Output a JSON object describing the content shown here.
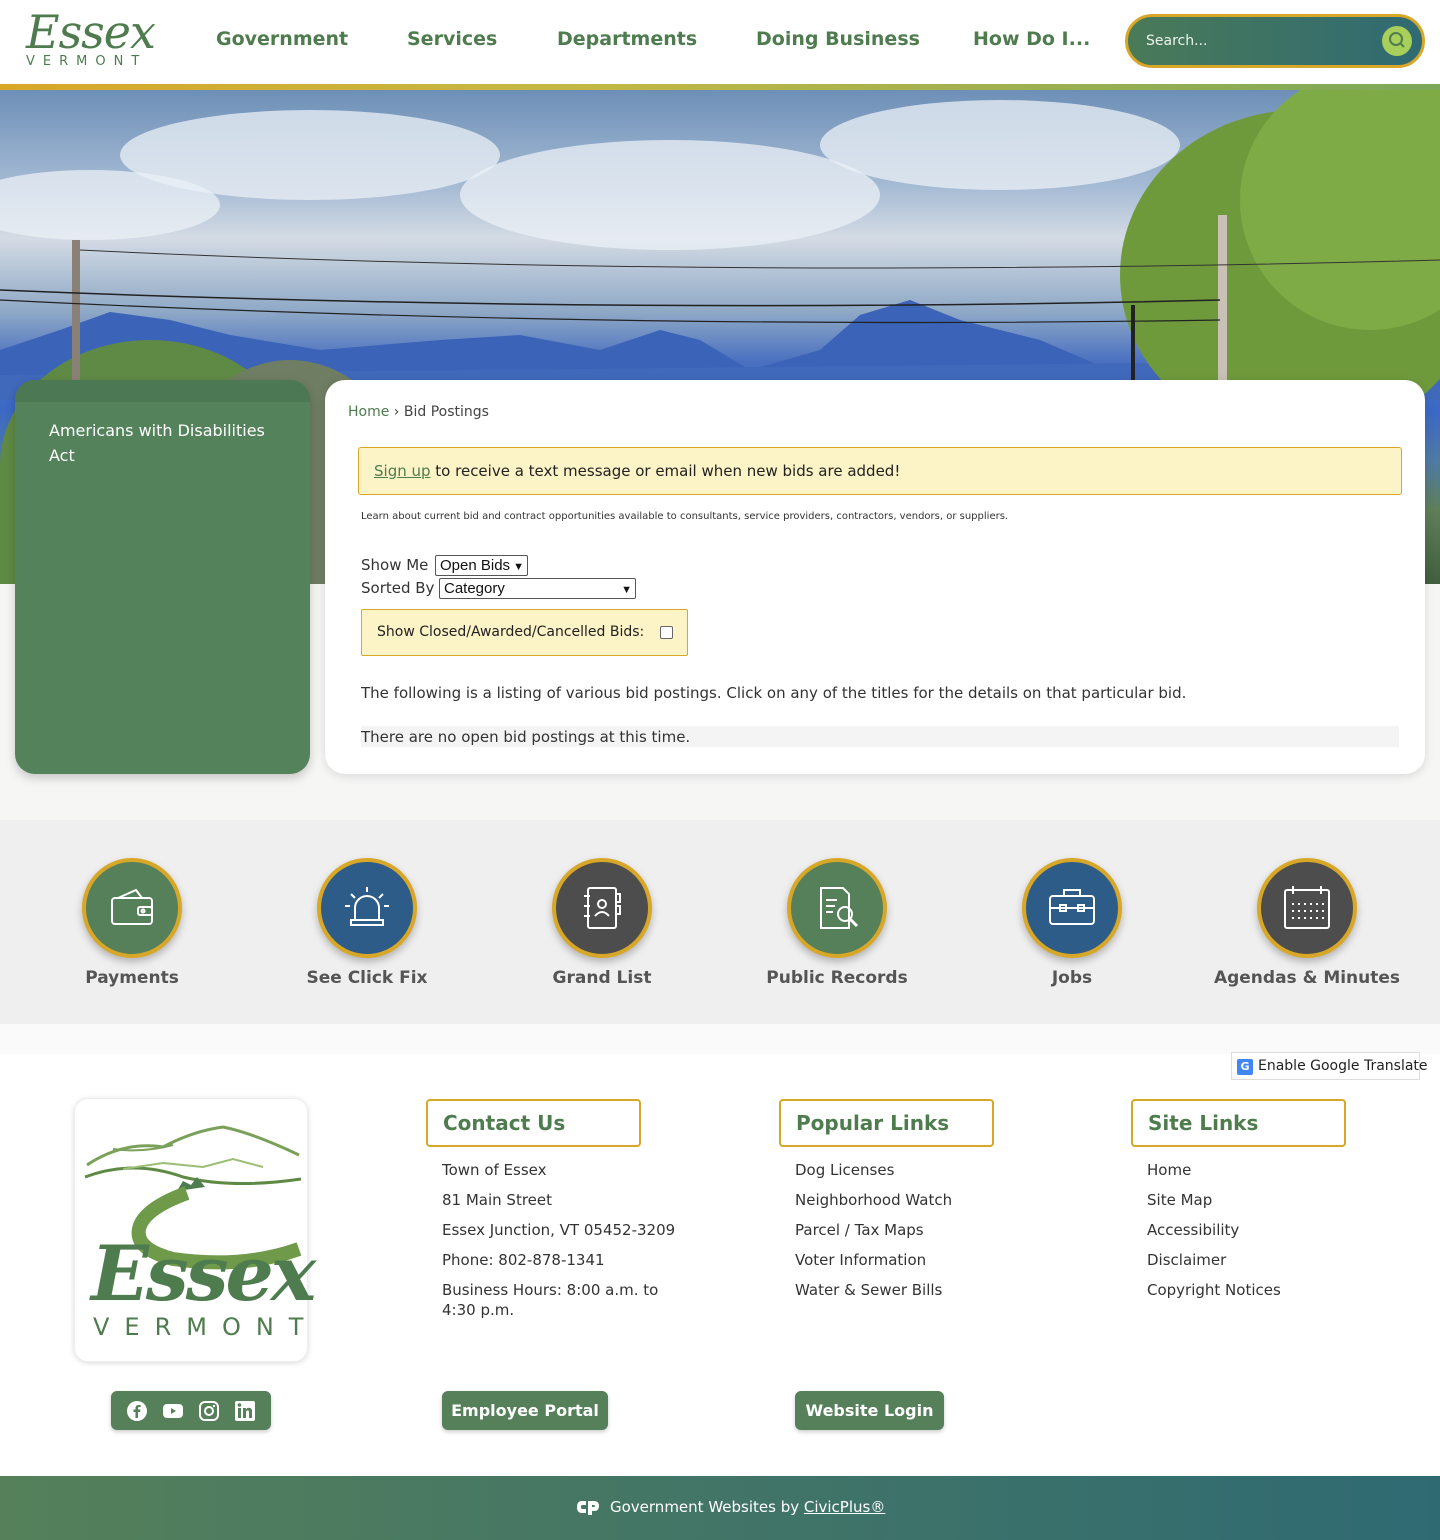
{
  "header": {
    "logo_word": "Essex",
    "logo_sub": "VERMONT",
    "nav": [
      "Government",
      "Services",
      "Departments",
      "Doing Business",
      "How Do I..."
    ],
    "search_placeholder": "Search..."
  },
  "sidebar": {
    "items": [
      {
        "label": "Americans with Disabilities Act"
      }
    ]
  },
  "breadcrumb": {
    "home": "Home",
    "separator": "›",
    "current": "Bid Postings"
  },
  "alert": {
    "link": "Sign up",
    "text": "to receive a text message or email when new bids are added!"
  },
  "intro": "Learn about current bid and contract opportunities available to consultants, service providers, contractors, vendors, or suppliers.",
  "filters": {
    "show_me_label": "Show Me",
    "show_me_value": "Open Bids",
    "sorted_by_label": "Sorted By",
    "sorted_by_value": "Category",
    "closed_label": "Show Closed/Awarded/Cancelled Bids:"
  },
  "listing_text": "The following is a listing of various bid postings. Click on any of the titles for the details on that particular bid.",
  "no_bids_text": "There are no open bid postings at this time.",
  "quick_links": [
    {
      "label": "Payments",
      "icon": "wallet-icon",
      "color": "#4f7c4e"
    },
    {
      "label": "See Click Fix",
      "icon": "siren-icon",
      "color": "#2c5c87"
    },
    {
      "label": "Grand List",
      "icon": "address-book-icon",
      "color": "#4d4d4d"
    },
    {
      "label": "Public Records",
      "icon": "document-search-icon",
      "color": "#4f7c4e"
    },
    {
      "label": "Jobs",
      "icon": "briefcase-icon",
      "color": "#2c5c87"
    },
    {
      "label": "Agendas & Minutes",
      "icon": "calendar-icon",
      "color": "#4d4d4d"
    }
  ],
  "translate": "Enable Google Translate",
  "footer": {
    "logo_word": "Essex",
    "logo_sub": "VERMONT",
    "contact": {
      "heading": "Contact Us",
      "lines": [
        "Town of Essex",
        "81 Main Street",
        "Essex Junction, VT 05452-3209",
        "Phone: 802-878-1341",
        "Business Hours: 8:00 a.m. to 4:30 p.m."
      ]
    },
    "popular": {
      "heading": "Popular Links",
      "links": [
        "Dog Licenses",
        "Neighborhood Watch",
        "Parcel / Tax Maps",
        "Voter Information",
        "Water & Sewer Bills"
      ]
    },
    "site": {
      "heading": "Site Links",
      "links": [
        "Home",
        "Site Map",
        "Accessibility",
        "Disclaimer",
        "Copyright Notices"
      ]
    },
    "employee_portal": "Employee Portal",
    "website_login": "Website Login",
    "credit_prefix": "Government Websites by",
    "credit_link": "CivicPlus®"
  },
  "colors": {
    "brand_green": "#4f7c4e",
    "gold": "#d8a728",
    "teal": "#2f6a73"
  }
}
